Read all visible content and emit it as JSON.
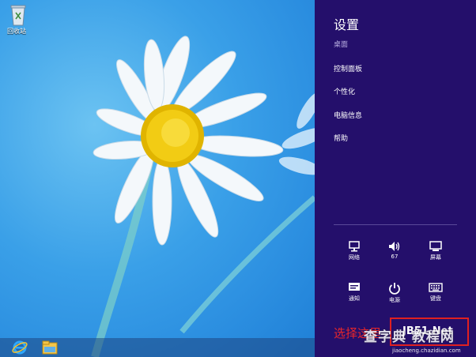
{
  "desktop": {
    "recycle_bin_label": "回收站"
  },
  "taskbar": {
    "items": [
      "internet-explorer-icon",
      "file-explorer-icon"
    ]
  },
  "settings": {
    "title": "设置",
    "subtitle": "桌面",
    "menu": [
      "控制面板",
      "个性化",
      "电脑信息",
      "帮助"
    ],
    "quick": [
      {
        "icon": "network-icon",
        "label": "网络"
      },
      {
        "icon": "volume-icon",
        "label": "67"
      },
      {
        "icon": "screen-icon",
        "label": "屏幕"
      },
      {
        "icon": "notifications-icon",
        "label": "通知"
      },
      {
        "icon": "power-icon",
        "label": "电源"
      },
      {
        "icon": "keyboard-icon",
        "label": "键盘"
      }
    ]
  },
  "annotation": {
    "hint": "选择这里",
    "highlight_text": "JB51.Net"
  },
  "watermark": {
    "text": "查字典 教程网",
    "url": "jiaocheng.chazidian.com"
  },
  "colors": {
    "panel_bg": "#240f6b",
    "hint_red": "#e8262a"
  }
}
